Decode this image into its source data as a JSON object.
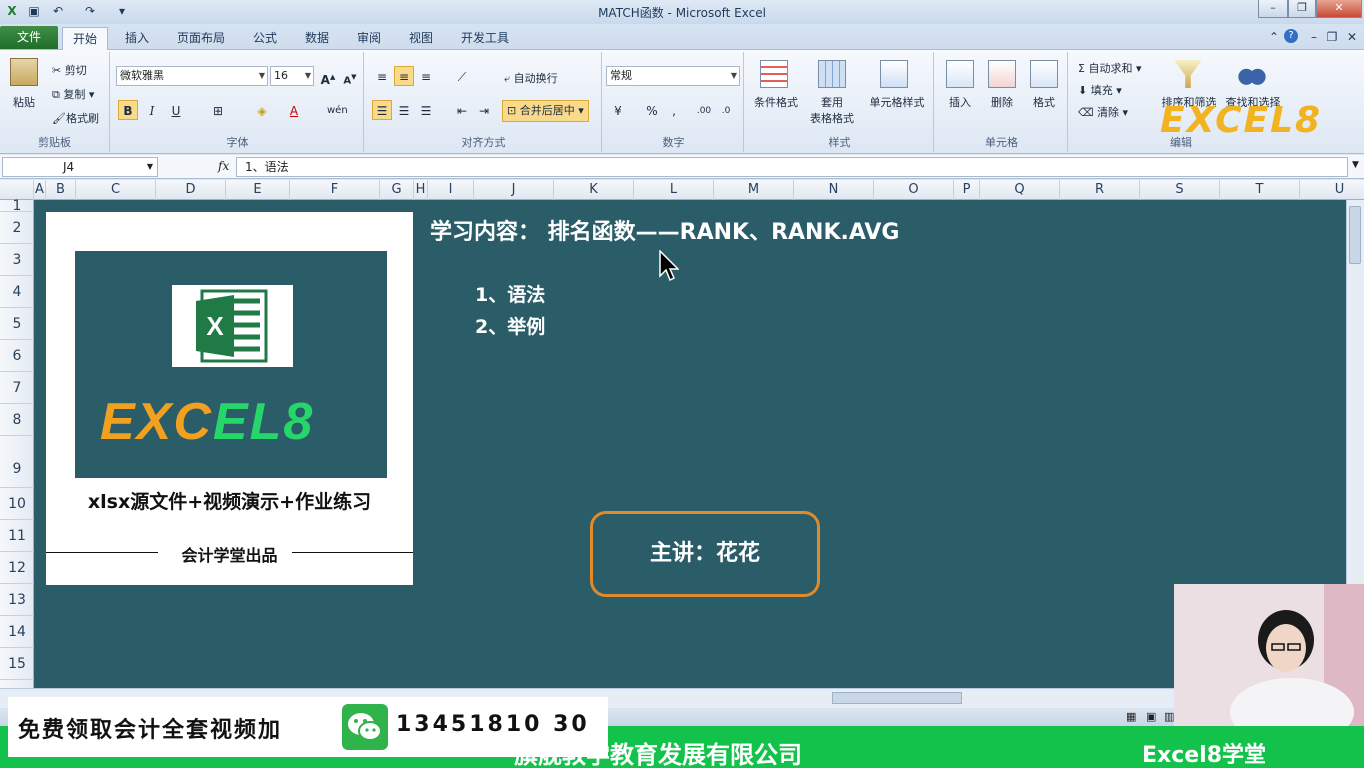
{
  "window": {
    "title": "MATCH函数 - Microsoft Excel"
  },
  "tabs": [
    "文件",
    "开始",
    "插入",
    "页面布局",
    "公式",
    "数据",
    "审阅",
    "视图",
    "开发工具"
  ],
  "ribbon": {
    "clipboard": {
      "paste": "粘贴",
      "cut": "剪切",
      "copy": "复制",
      "format_painter": "格式刷",
      "label": "剪贴板"
    },
    "font": {
      "name": "微软雅黑",
      "size": "16",
      "label": "字体"
    },
    "alignment": {
      "wrap": "自动换行",
      "merge": "合并后居中",
      "label": "对齐方式"
    },
    "number": {
      "format": "常规",
      "label": "数字"
    },
    "styles": {
      "conditional": "条件格式",
      "table_line1": "套用",
      "table_line2": "表格格式",
      "cell_styles": "单元格样式",
      "label": "样式"
    },
    "cells": {
      "insert": "插入",
      "delete": "删除",
      "format": "格式",
      "label": "单元格"
    },
    "editing": {
      "autosum": "自动求和",
      "fill": "填充",
      "clear": "清除",
      "sort": "排序和筛选",
      "find": "查找和选择",
      "label": "编辑"
    }
  },
  "formula_bar": {
    "name_box": "J4",
    "fx": "fx",
    "formula": "1、语法"
  },
  "columns": [
    "A",
    "B",
    "C",
    "D",
    "E",
    "F",
    "G",
    "H",
    "I",
    "J",
    "K",
    "L",
    "M",
    "N",
    "O",
    "P",
    "Q",
    "R",
    "S",
    "T",
    "U"
  ],
  "rows": [
    "1",
    "2",
    "3",
    "4",
    "5",
    "6",
    "7",
    "8",
    "9",
    "10",
    "11",
    "12",
    "13",
    "14",
    "15"
  ],
  "content": {
    "card_line1": "xlsx源文件+视频演示+作业练习",
    "card_line2": "会计学堂出品",
    "logo_text": "EXCEL8",
    "heading": "学习内容： 排名函数——RANK、RANK.AVG",
    "item1": "1、语法",
    "item2": "2、举例",
    "lecturer": "主讲：花花"
  },
  "overlay": {
    "promo_text": "免费领取会计全套视频加",
    "promo_phone": "13451810 30",
    "company": "旗舰教学教育发展有限公司",
    "brand": "Excel8学堂",
    "watermark": "EXCEL8"
  },
  "colors": {
    "sheet_bg": "#2a5d68",
    "accent_orange": "#e08a2c",
    "green_bar": "#13c24a",
    "logo_green": "#27d66b",
    "logo_orange": "#f2a020"
  }
}
